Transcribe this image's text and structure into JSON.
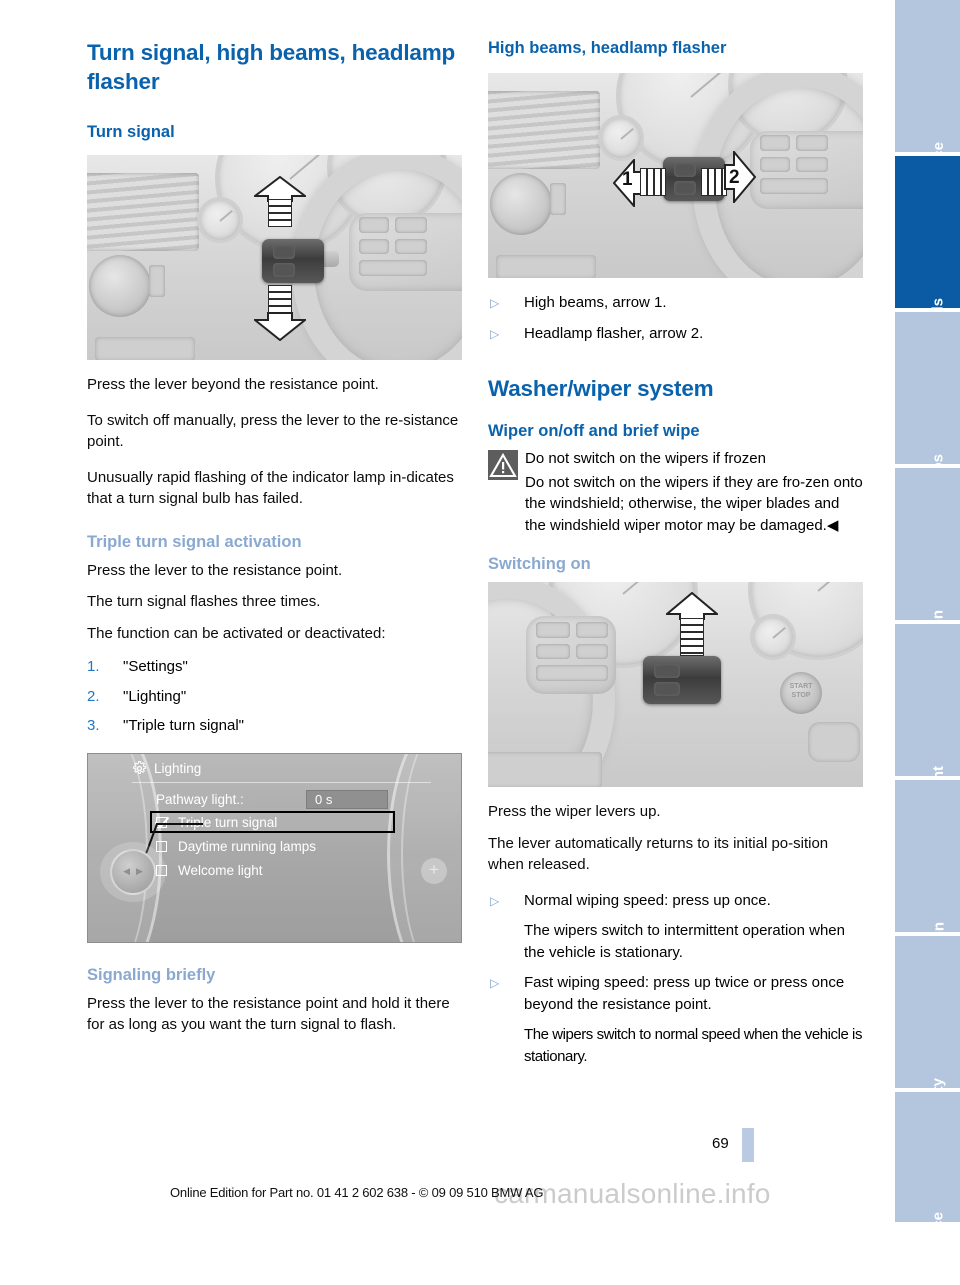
{
  "document": {
    "page_number": "69",
    "footer_text": "Online Edition for Part no. 01 41 2 602 638 - © 09 09 510 BMW AG",
    "watermark": "carmanualsonline.info",
    "colors": {
      "heading_blue": "#0a62ac",
      "subheading_blue": "#8aa9d0",
      "tab_active": "#0a5ba3",
      "tab_inactive": "#b4c5de",
      "bullet_blue": "#7fa5cf",
      "number_blue": "#2277c4"
    }
  },
  "left_column": {
    "title": "Turn signal, high beams, headlamp flasher",
    "turn_signal": {
      "heading": "Turn signal",
      "figure_name": "turn-signal-stalk-photo",
      "paragraphs": [
        "Press the lever beyond the resistance point.",
        "To switch off manually, press the lever to the re-sistance point.",
        "Unusually rapid flashing of the indicator lamp in-dicates that a turn signal bulb has failed."
      ]
    },
    "triple_turn_signal": {
      "heading": "Triple turn signal activation",
      "paragraphs": [
        "Press the lever to the resistance point.",
        "The turn signal flashes three times.",
        "The function can be activated or deactivated:"
      ],
      "steps": [
        {
          "num": "1.",
          "label": "\"Settings\""
        },
        {
          "num": "2.",
          "label": "\"Lighting\""
        },
        {
          "num": "3.",
          "label": "\"Triple turn signal\""
        }
      ]
    },
    "idrive_screen": {
      "title": "Lighting",
      "gear_icon": "gear-icon",
      "pathway_label": "Pathway light.:",
      "pathway_value": "0 s",
      "options": [
        {
          "label": "Triple turn signal",
          "checked": true,
          "highlighted": true
        },
        {
          "label": "Daytime running lamps",
          "checked": false,
          "highlighted": false
        },
        {
          "label": "Welcome light",
          "checked": false,
          "highlighted": false
        }
      ],
      "plus_button": "+"
    },
    "signaling_briefly": {
      "heading": "Signaling briefly",
      "paragraphs": [
        "Press the lever to the resistance point and hold it there for as long as you want the turn signal to flash."
      ]
    }
  },
  "right_column": {
    "high_beams": {
      "heading": "High beams, headlamp flasher",
      "figure_name": "high-beams-stalk-photo",
      "arrow_labels": [
        "1",
        "2"
      ],
      "bullets": [
        "High beams, arrow 1.",
        "Headlamp flasher, arrow 2."
      ]
    },
    "washer_wiper": {
      "title": "Washer/wiper system",
      "wiper_onoff": {
        "heading": "Wiper on/off and brief wipe",
        "warning": {
          "icon": "warning-triangle-icon",
          "headline": "Do not switch on the wipers if frozen",
          "body": "Do not switch on the wipers if they are fro-zen onto the windshield; otherwise, the wiper blades and the windshield wiper motor may be damaged.◀"
        }
      },
      "switching_on": {
        "heading": "Switching on",
        "figure_name": "wiper-stalk-photo",
        "paragraphs": [
          "Press the wiper levers up.",
          "The lever automatically returns to its initial po-sition when released."
        ],
        "bullets": [
          {
            "text": "Normal wiping speed: press up once.",
            "note": "The wipers switch to intermittent operation when the vehicle is stationary."
          },
          {
            "text": "Fast wiping speed: press up twice or press once beyond the resistance point.",
            "note": "The wipers switch to normal speed when the vehicle is stationary."
          }
        ]
      }
    }
  },
  "sidebar": {
    "tabs": [
      {
        "label": "At a glance",
        "active": false
      },
      {
        "label": "Controls",
        "active": true
      },
      {
        "label": "Driving tips",
        "active": false
      },
      {
        "label": "Navigation",
        "active": false
      },
      {
        "label": "Entertainment",
        "active": false
      },
      {
        "label": "Communication",
        "active": false
      },
      {
        "label": "Mobility",
        "active": false
      },
      {
        "label": "Reference",
        "active": false
      }
    ]
  }
}
